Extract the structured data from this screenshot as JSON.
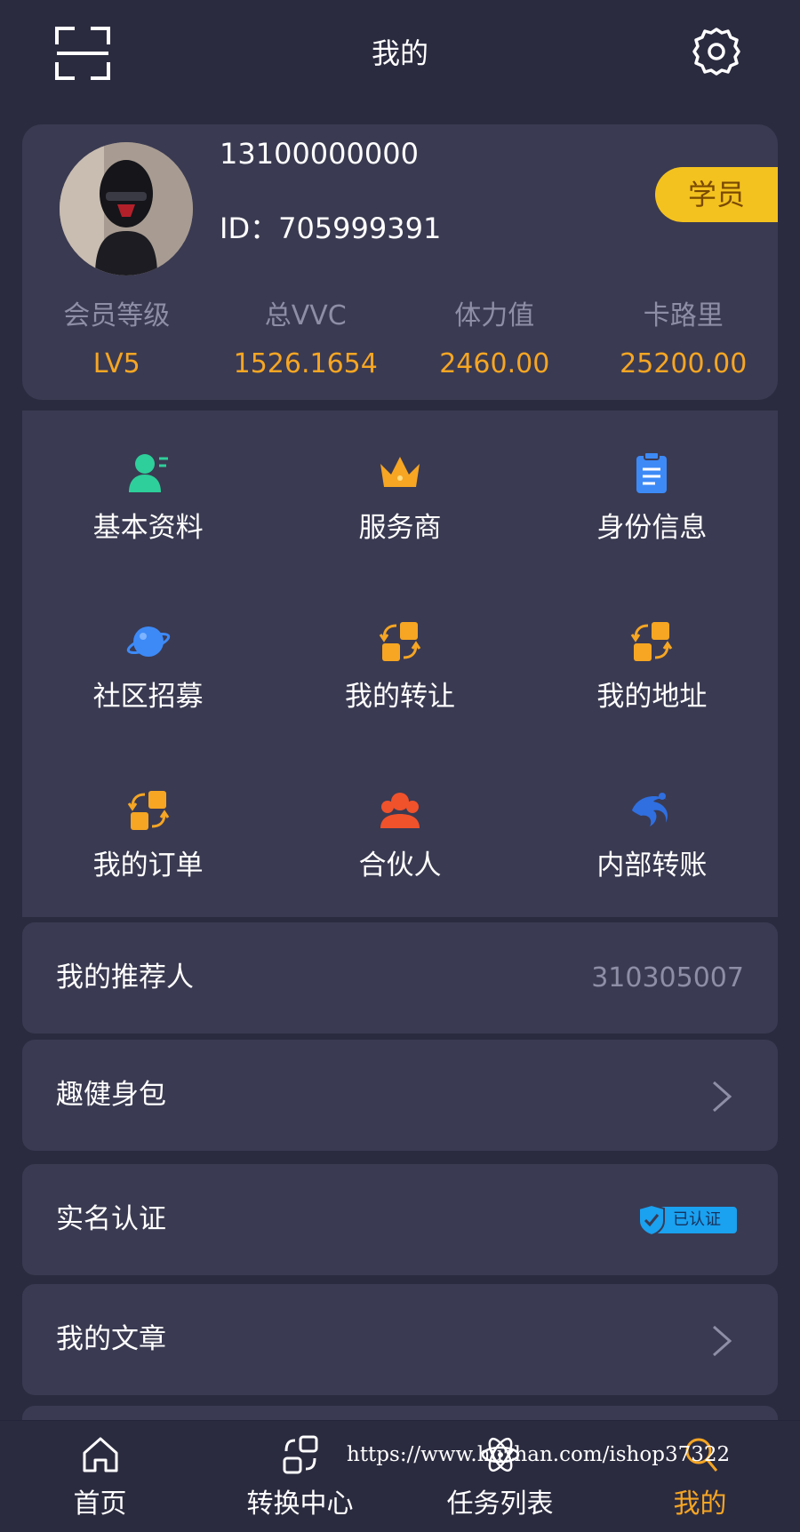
{
  "header": {
    "title": "我的"
  },
  "profile": {
    "phone": "13100000000",
    "id_label": "ID：705999391",
    "badge": "学员",
    "stats": [
      {
        "label": "会员等级",
        "value": "LV5"
      },
      {
        "label": "总VVC",
        "value": "1526.1654"
      },
      {
        "label": "体力值",
        "value": "2460.00"
      },
      {
        "label": "卡路里",
        "value": "25200.00"
      }
    ]
  },
  "grid": {
    "items": [
      {
        "label": "基本资料",
        "icon": "user-profile-icon"
      },
      {
        "label": "服务商",
        "icon": "crown-icon"
      },
      {
        "label": "身份信息",
        "icon": "clipboard-icon"
      },
      {
        "label": "社区招募",
        "icon": "planet-icon"
      },
      {
        "label": "我的转让",
        "icon": "transfer-icon"
      },
      {
        "label": "我的地址",
        "icon": "transfer-icon"
      },
      {
        "label": "我的订单",
        "icon": "transfer-icon"
      },
      {
        "label": "合伙人",
        "icon": "partner-icon"
      },
      {
        "label": "内部转账",
        "icon": "swirl-icon"
      }
    ]
  },
  "rows": {
    "referrer": {
      "label": "我的推荐人",
      "value": "310305007"
    },
    "fitness_pack": {
      "label": "趣健身包"
    },
    "real_name": {
      "label": "实名认证",
      "badge": "已认证"
    },
    "articles": {
      "label": "我的文章"
    }
  },
  "nav": {
    "items": [
      {
        "label": "首页",
        "icon": "home-icon"
      },
      {
        "label": "转换中心",
        "icon": "exchange-icon"
      },
      {
        "label": "任务列表",
        "icon": "atom-icon"
      },
      {
        "label": "我的",
        "icon": "search-user-icon"
      }
    ],
    "active_color": "#f6a623"
  },
  "watermark": "https://www.huzhan.com/ishop37322",
  "colors": {
    "background": "#2b2b40",
    "card": "#3a3a52",
    "accent": "#f6a623",
    "badge": "#f4c21f"
  }
}
